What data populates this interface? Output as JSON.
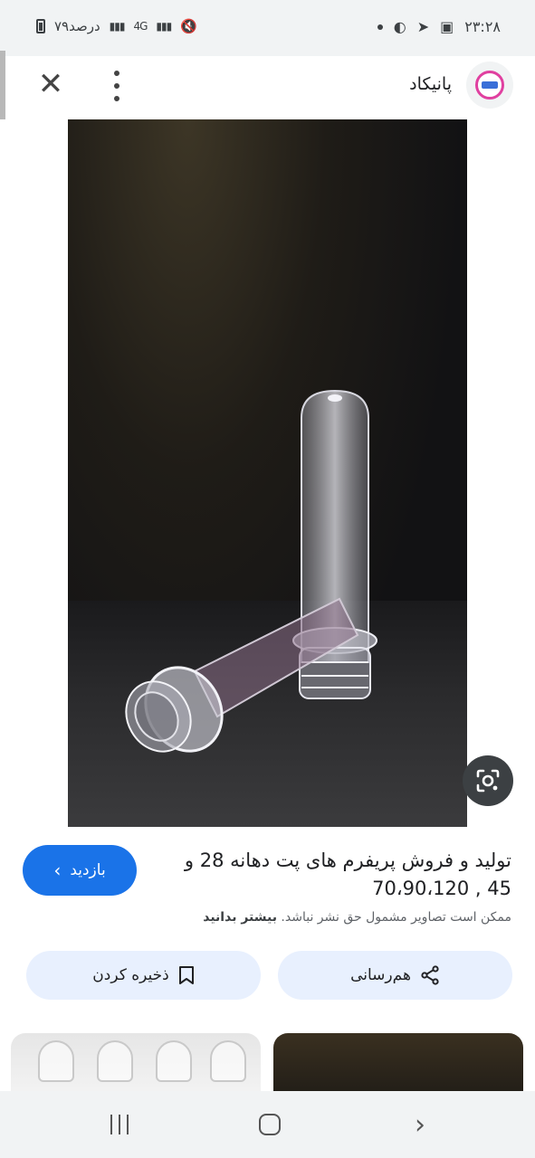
{
  "status_bar": {
    "time": "۲۳:۲۸",
    "battery_text": "۷۹درصد",
    "network": "4G",
    "icons": [
      "gallery-icon",
      "telegram-icon",
      "vpn-icon",
      "dot-icon",
      "mute-icon",
      "signal-icon",
      "battery-icon"
    ]
  },
  "header": {
    "site_name": "پانیکاد",
    "close_icon": "close-icon",
    "more_icon": "more-vert-icon"
  },
  "image": {
    "lens_icon": "google-lens-icon"
  },
  "info": {
    "title": "تولید و فروش پریفرم های پت دهانه 28 و 45 , 70،90،120",
    "visit_label": "بازدید",
    "notice_text": "ممکن است تصاویر مشمول حق نشر نباشد.",
    "notice_link": "بیشتر بدانید",
    "share_label": "هم‌رسانی",
    "save_label": "ذخیره کردن"
  },
  "nav_bar": {
    "icons": [
      "recent-apps-icon",
      "home-icon",
      "back-icon"
    ]
  },
  "colors": {
    "primary": "#1a73e8",
    "chip_bg": "#e8f0fe",
    "status_bg": "#f1f3f4"
  }
}
